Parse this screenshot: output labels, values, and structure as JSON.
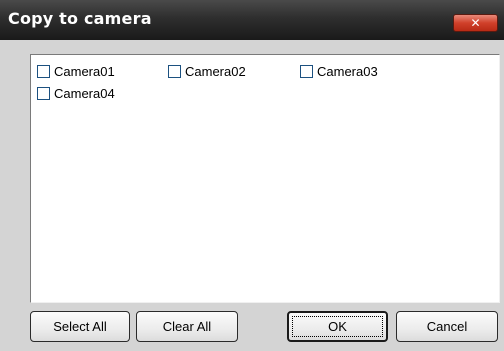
{
  "window": {
    "title": "Copy to camera",
    "close_glyph": "✕"
  },
  "cameras": [
    {
      "label": "Camera01",
      "checked": false
    },
    {
      "label": "Camera02",
      "checked": false
    },
    {
      "label": "Camera03",
      "checked": false
    },
    {
      "label": "Camera04",
      "checked": false
    }
  ],
  "buttons": {
    "select_all": "Select All",
    "clear_all": "Clear All",
    "ok": "OK",
    "cancel": "Cancel"
  },
  "colors": {
    "titlebar": "#2e2e2e",
    "close_button": "#d0402a",
    "dialog_background": "#d4d4d4",
    "checkbox_border": "#1c5180"
  }
}
